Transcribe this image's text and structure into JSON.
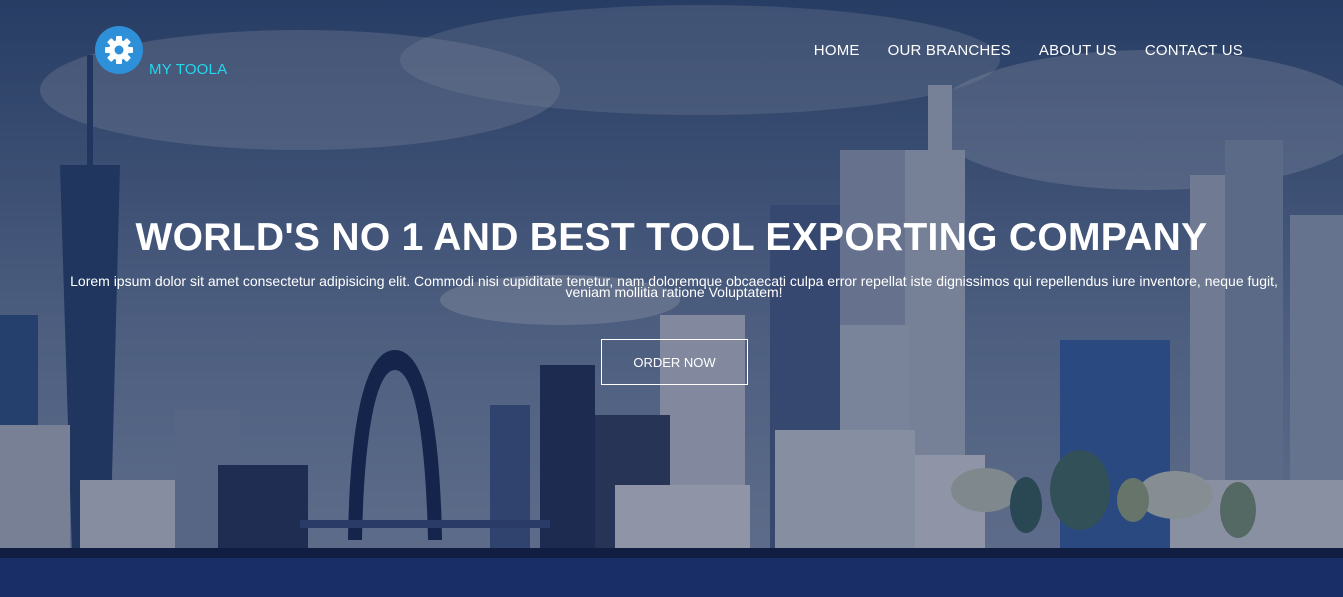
{
  "brand": {
    "name": "MY TOOLA",
    "icon": "gear-icon",
    "badge_color": "#2e90d9",
    "text_color": "#22d8ef"
  },
  "nav": {
    "items": [
      {
        "label": "HOME"
      },
      {
        "label": "OUR BRANCHES"
      },
      {
        "label": "ABOUT US"
      },
      {
        "label": "CONTACT US"
      }
    ]
  },
  "hero": {
    "title": "WORLD'S NO 1 AND BEST TOOL EXPORTING COMPANY",
    "description": "Lorem ipsum dolor sit amet consectetur adipisicing elit. Commodi nisi cupiditate tenetur, nam doloremque obcaecati culpa error repellat iste dignissimos qui repellendus iure inventore, neque fugit, veniam mollitia ratione Voluptatem!",
    "cta_label": "ORDER NOW",
    "background": "city-skyline-illustration",
    "overlay_color": "#0c1637"
  }
}
